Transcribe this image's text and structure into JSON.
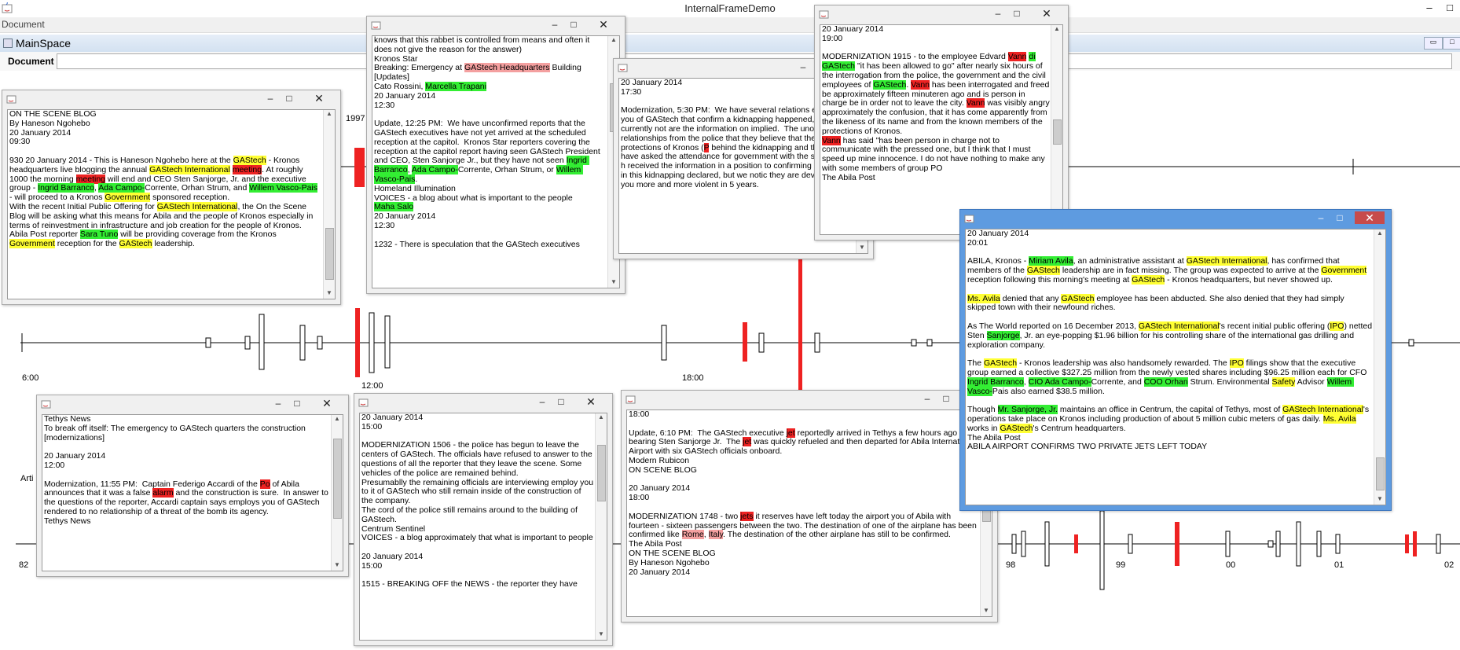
{
  "app": {
    "title": "InternalFrameDemo",
    "menu": "Document",
    "mainspace": "MainSpace",
    "doc_label": "Document",
    "doc_value": ""
  },
  "colors": {
    "highlight_org": "#ffff33",
    "highlight_person": "#33ee33",
    "highlight_alert": "#ee2222",
    "highlight_place": "#f4a0a0",
    "event_bar": "#ee2222",
    "active_frame": "#5e9be0"
  },
  "timeline": {
    "upper_labels": [
      "6:00",
      "12:00",
      "18:00"
    ],
    "upper_year": "1997",
    "lower_labels": [
      "82",
      "98",
      "99",
      "00",
      "01",
      "02"
    ],
    "left_stub": "Arti"
  },
  "frames": [
    {
      "id": "f1",
      "text": "ON THE SCENE BLOG\nBy Haneson Ngohebo\n20 January 2014\n09:30\n\n930 20 January 2014 - This is Haneson Ngohebo here at the [y:GAStech] - Kronos headquarters live blogging the annual [y:GAStech International] [r:meeting]. At roughly 1000 the morning [r:meeting] will end and CEO Sten Sanjorge, Jr. and the executive group - [g:Ingrid Barranco], [g:Ada Campo-]Corrente, Orhan Strum, and [g:Willem Vasco-Pais] - will proceed to a Kronos [y:Government] sponsored reception.\nWith the recent Initial Public Offering for [y:GAStech International], the On the Scene Blog will be asking what this means for Abila and the people of Kronos especially in terms of reinvestment in infrastructure and job creation for the people of Kronos.\nAbila Post reporter [g:Sara Tuno] will be providing coverage from the Kronos [y:Government] reception for the [y:GAStech] leadership."
    },
    {
      "id": "f2",
      "text": "knows that this rabbet is controlled from means and often it does not give the reason for the answer)\nKronos Star\nBreaking: Emergency at [p:GAStech Headquarters] Building [Updates]\nCato Rossini, [g:Marcella Trapani]\n20 January 2014\n12:30\n\nUpdate, 12:25 PM:  We have unconfirmed reports that the GAStech executives have not yet arrived at the scheduled reception at the capitol.  Kronos Star reporters covering the reception at the capitol report having seen GAStech President and CEO, Sten Sanjorge Jr., but they have not seen [g:Ingrid Barranco], [g:Ada Campo-]Corrente, Orhan Strum, or [g:Willem Vasco-Pais].\nHomeland Illumination\nVOICES - a blog about what is important to the people\n[g:Maha Salo]\n20 January 2014\n12:30\n\n1232 - There is speculation that the GAStech executives"
    },
    {
      "id": "f3",
      "text": "20 January 2014\n17:30\n\nModernization, 5:30 PM:  We have several relations employs you of GAStech that confirm a kidnapping happened, but currently not are the information on implied.  The unofficial relationships from the police that they believe that the protections of Kronos ([r:P] behind the kidnapping and that they have asked the attendance for government with the search.  We h received the information in a position to confirming of the [r:POK] in this kidnapping declared, but we notic they are develops to you more and more violent in 5 years."
    },
    {
      "id": "f4",
      "text": "20 January 2014\n19:00\n\nMODERNIZATION 1915 - to the employee Edvard [r:Vann] [g:di] [g:GAStech] \"it has been allowed to go\" after nearly six hours of the interrogation from the police, the government and the civil employees of [g:GAStech]. [r:Vann] has been interrogated and freed be approximately fifteen minuteren ago and is person in charge be in order not to leave the city. [r:Vann] was visibly angry approximately the confusion, that it has come apparently from the likeness of its name and from the known members of the protections of Kronos.\n[r:Vann] has said \"has been person in charge not to communicate with the pressed one, but I think that I must speed up mine innocence. I do not have nothing to make any with some members of group PO\nThe Abila Post"
    },
    {
      "id": "f5",
      "text": "20 January 2014\n20:01\n\nABILA, Kronos - [g:Miriam Avila], an administrative assistant at [y:GAStech International], has confirmed that members of the [y:GAStech] leadership are in fact missing. The group was expected to arrive at the [y:Government] reception following this morning's meeting at [y:GAStech] - Kronos headquarters, but never showed up.\n\n[y:Ms. Avila] denied that any [y:GAStech] employee has been abducted. She also denied that they had simply skipped town with their newfound riches.\n\nAs The World reported on 16 December 2013, [y:GAStech International]'s recent initial public offering ([y:IPO]) netted Sten [g:Sanjorge], Jr. an eye-popping $1.96 billion for his controlling share of the international gas drilling and exploration company.\n\nThe [y:GAStech] - Kronos leadership was also handsomely rewarded. The [y:IPO] filings show that the executive group earned a collective $327.25 million from the newly vested shares including $96.25 million each for CFO [g:Ingrid Barranco], [g:CIO Ada Campo-]Corrente, and [g:COO Orhan] Strum. Environmental [y:Safety] Advisor [g:Willem Vasco-]Pais also earned $38.5 million.\n\nThough [g:Mr. Sanjorge, Jr.] maintains an office in Centrum, the capital of Tethys, most of [y:GAStech International]'s operations take place on Kronos including production of about 5 million cubic meters of gas daily. [y:Ms. Avila] works in [y:GAStech]'s Centrum headquarters.\nThe Abila Post\nABILA AIRPORT CONFIRMS TWO PRIVATE JETS LEFT TODAY"
    },
    {
      "id": "f6",
      "text": "Tethys News\nTo break off itself: The emergency to GAStech quarters the construction [modernizations]\n\n20 January 2014\n12:00\n\nModernization, 11:55 PM:  Captain Federigo Accardi of the [r:Po] of Abila announces that it was a false [r:alarm] and the construction is sure.  In answer to the questions of the reporter, Accardi captain says employs you of GAStech rendered to no relationship of a threat of the bomb its agency.\nTethys News"
    },
    {
      "id": "f7",
      "text": "20 January 2014\n15:00\n\nMODERNIZATION 1506 - the police has begun to leave the centers of GAStech. The officials have refused to answer to the questions of all the reporter that they leave the scene. Some vehicles of the police are remained behind.\nPresumablly the remaining officials are interviewing employ you to it of GAStech who still remain inside of the construction of the company.\nThe cord of the police still remains around to the building of GAStech.\nCentrum Sentinel\nVOICES - a blog approximately that what is important to people\n\n20 January 2014\n15:00\n\n1515 - BREAKING OFF the NEWS - the reporter they have"
    },
    {
      "id": "f8",
      "text": "18:00\n\nUpdate, 6:10 PM:  The GAStech executive [r:jet] reportedly arrived in Tethys a few hours ago bearing Sten Sanjorge Jr.  The [r:jet] was quickly refueled and then departed for Abila International Airport with six GAStech officials onboard.\nModern Rubicon\nON SCENE BLOG\n\n20 January 2014\n18:00\n\nMODERNIZATION 1748 - two [r:jets] it reserves have left today the airport you of Abila with fourteen - sixteen passengers between the two. The destination of one of the airplane has been confirmed like [p:Rome], [p:Italy]. The destination of the other airplane has still to be confirmed.\nThe Abila Post\nON THE SCENE BLOG\nBy Haneson Ngohebo\n20 January 2014"
    }
  ]
}
